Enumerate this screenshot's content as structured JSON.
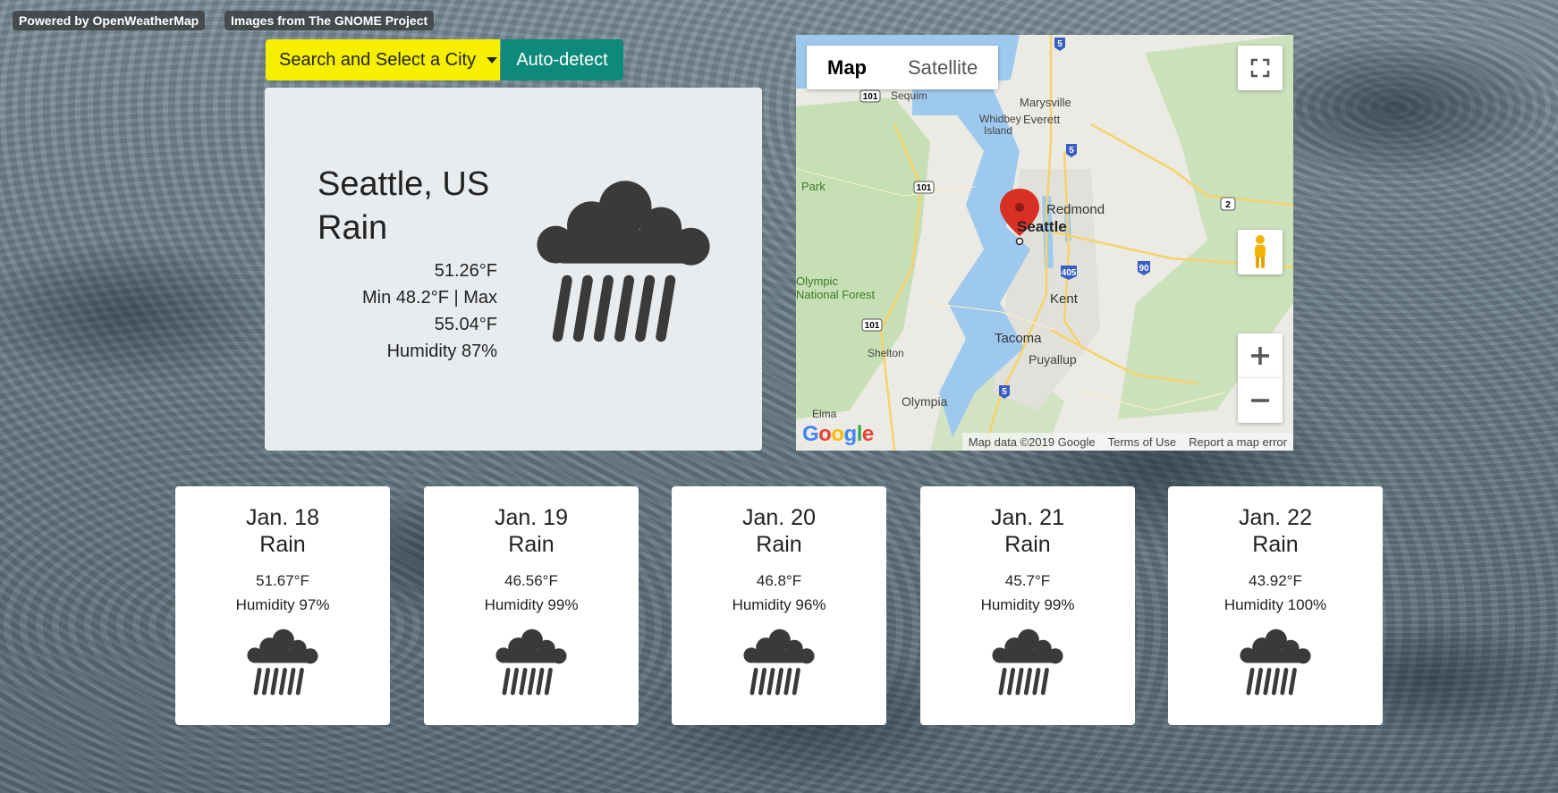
{
  "credits": {
    "weather": "Powered by OpenWeatherMap",
    "images": "Images from The GNOME Project"
  },
  "controls": {
    "search_label": "Search and Select a City",
    "autodetect_label": "Auto-detect"
  },
  "current": {
    "city": "Seattle, US",
    "condition": "Rain",
    "temp": "51.26°F",
    "minmax_line1": "Min 48.2°F | Max",
    "minmax_line2": "55.04°F",
    "humidity": "Humidity 87%",
    "icon": "rain-cloud-icon"
  },
  "map": {
    "tab_map": "Map",
    "tab_satellite": "Satellite",
    "logo": "Google",
    "data_text": "Map data ©2019 Google",
    "terms": "Terms of Use",
    "report": "Report a map error",
    "places": {
      "seattle": "Seattle",
      "redmond": "Redmond",
      "kent": "Kent",
      "tacoma": "Tacoma",
      "puyallup": "Puyallup",
      "olympia": "Olympia",
      "shelton": "Shelton",
      "marysville": "Marysville",
      "everett": "Everett",
      "whidbey": "Whidbey",
      "island": "Island",
      "sequim": "Sequim",
      "elma": "Elma",
      "olympic": "Olympic",
      "national_forest": "National Forest",
      "park": "Park"
    },
    "routes": [
      "101",
      "5",
      "405",
      "90",
      "2"
    ]
  },
  "forecast": [
    {
      "date": "Jan. 18",
      "condition": "Rain",
      "temp": "51.67°F",
      "humidity": "Humidity 97%"
    },
    {
      "date": "Jan. 19",
      "condition": "Rain",
      "temp": "46.56°F",
      "humidity": "Humidity 99%"
    },
    {
      "date": "Jan. 20",
      "condition": "Rain",
      "temp": "46.8°F",
      "humidity": "Humidity 96%"
    },
    {
      "date": "Jan. 21",
      "condition": "Rain",
      "temp": "45.7°F",
      "humidity": "Humidity 99%"
    },
    {
      "date": "Jan. 22",
      "condition": "Rain",
      "temp": "43.92°F",
      "humidity": "Humidity 100%"
    }
  ],
  "colors": {
    "search_button": "#f6f000",
    "autodetect_button": "#0e8a7c",
    "icon": "#3a3a3a",
    "map_pin": "#d93025"
  }
}
